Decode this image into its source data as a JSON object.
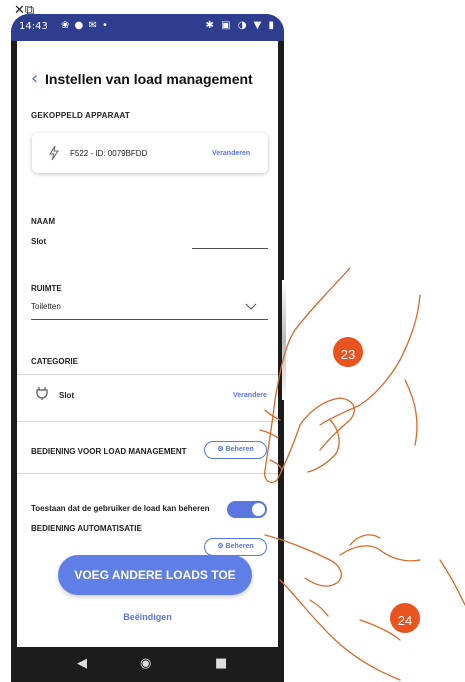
{
  "corner": {
    "icons": "✕⧉"
  },
  "status": {
    "time": "14:43",
    "left_icons": "❀ ● ✉ •",
    "right_icons": "✱ ▣ ◑ ▼ ▮"
  },
  "header": {
    "back": "‹",
    "title": "Instellen van load management"
  },
  "device": {
    "section": "GEKOPPELD APPARAAT",
    "icon": "bolt-icon",
    "name": "F522 - ID: 0079BFDD",
    "change": "Veranderen"
  },
  "naam": {
    "label": "NAAM",
    "value": "Slot"
  },
  "ruimte": {
    "label": "RUIMTE",
    "value": "Toiletten"
  },
  "categorie": {
    "label": "CATEGORIE",
    "icon": "plug-icon",
    "value": "Slot",
    "change": "Verandere"
  },
  "load_control": {
    "label": "BEDIENING VOOR LOAD MANAGEMENT",
    "button": "Beheren"
  },
  "allow_user": {
    "label": "Toestaan dat de gebruiker de load kan beheren",
    "enabled": true
  },
  "automation": {
    "label": "BEDIENING AUTOMATISATIE",
    "button": "Beheren"
  },
  "add_button": "VOEG ANDERE LOADS TOE",
  "finish": "Beëindigen",
  "navbar": {
    "back": "◀",
    "home": "◉",
    "recent": "■"
  },
  "annotations": {
    "badge_1": "23",
    "badge_2": "24"
  },
  "colors": {
    "accent": "#5a76e0",
    "status_bar": "#2f3d8f",
    "badge": "#e8531f"
  }
}
